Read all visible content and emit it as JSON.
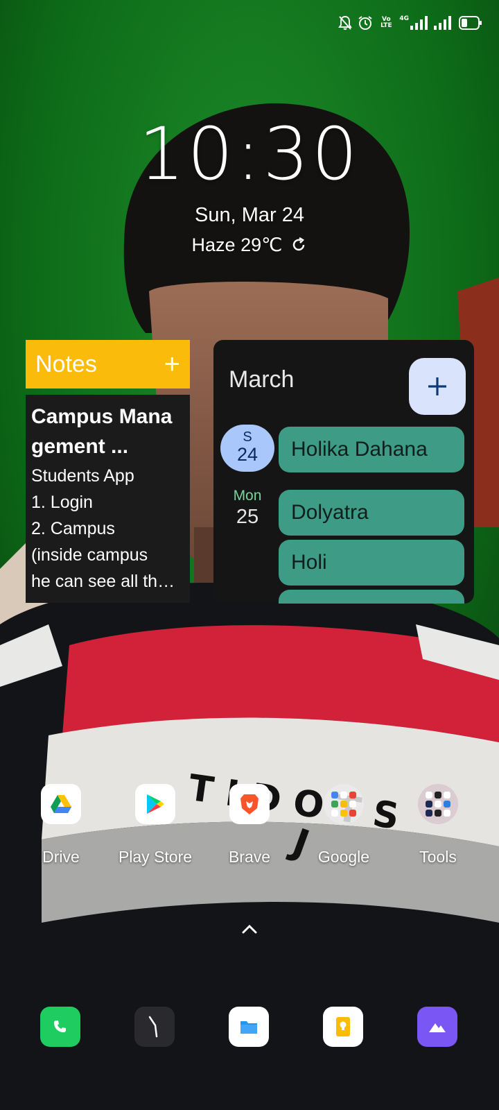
{
  "status_bar": {
    "icons": [
      "bell-muted-icon",
      "alarm-icon",
      "volte-icon",
      "signal-4g-icon",
      "signal-icon",
      "battery-icon"
    ],
    "volte_text_top": "Vo",
    "volte_text_bottom": "LTE",
    "network_text": "4G"
  },
  "clock": {
    "time": "10:30",
    "date": "Sun, Mar 24",
    "weather": "Haze 29℃"
  },
  "notes_widget": {
    "header": "Notes",
    "add_label": "+",
    "note_title": "Campus Management ...",
    "note_lines": [
      "Students App",
      "1. Login",
      "2. Campus",
      "(inside campus",
      "he can see all th…"
    ]
  },
  "calendar_widget": {
    "month": "March",
    "days": [
      {
        "weekday": "S",
        "day": "24",
        "events": [
          "Holika Dahana"
        ]
      },
      {
        "weekday": "Mon",
        "day": "25",
        "events": [
          "Dolyatra",
          "Holi"
        ]
      }
    ]
  },
  "apps": [
    {
      "label": "Drive",
      "icon": "google-drive-icon"
    },
    {
      "label": "Play Store",
      "icon": "play-store-icon"
    },
    {
      "label": "Brave",
      "icon": "brave-lion-icon"
    },
    {
      "label": "Google",
      "icon": "folder-icon"
    },
    {
      "label": "Tools",
      "icon": "folder-icon"
    }
  ],
  "dock": [
    {
      "icon": "phone-icon",
      "color": "#1fcc5f"
    },
    {
      "icon": "clock-icon",
      "color": "#2a2a2e"
    },
    {
      "icon": "files-icon",
      "color": "#ffffff"
    },
    {
      "icon": "keep-notes-icon",
      "color": "#ffffff"
    },
    {
      "icon": "gallery-icon",
      "color": "#7a56f5"
    }
  ],
  "colors": {
    "notes_accent": "#fbbb0a",
    "event_color": "#3e9b86",
    "today_highlight": "#a9c7fa",
    "wallpaper_green": "#0d6b1a"
  }
}
